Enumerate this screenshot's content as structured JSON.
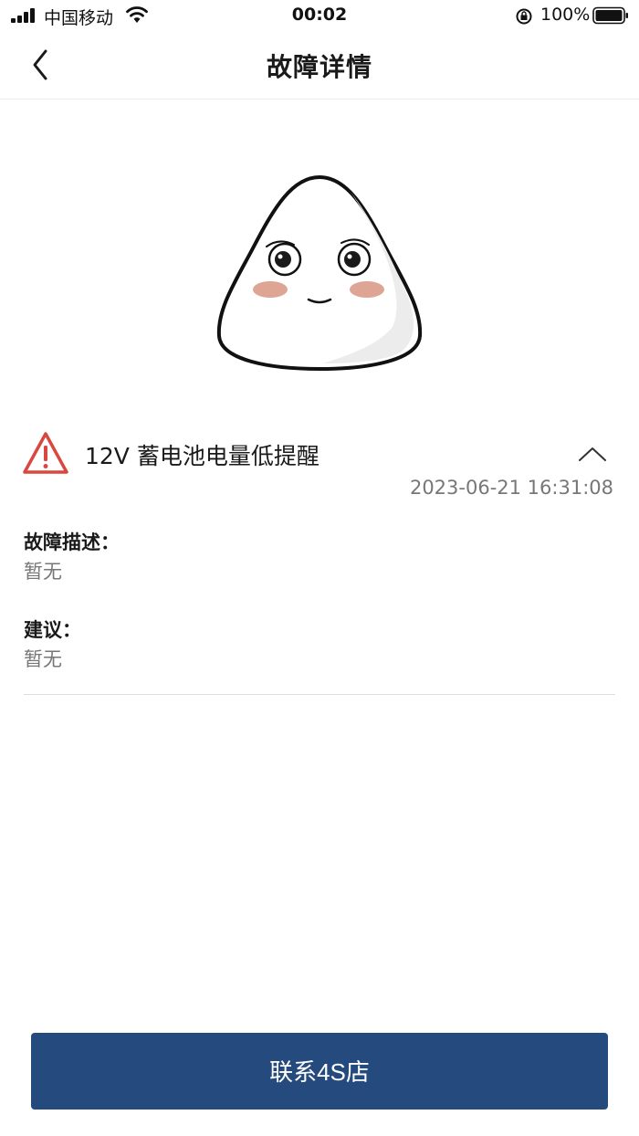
{
  "status_bar": {
    "carrier": "中国移动",
    "time": "00:02",
    "battery": "100%"
  },
  "nav": {
    "title": "故障详情"
  },
  "fault": {
    "title": "12V 蓄电池电量低提醒",
    "time": "2023-06-21 16:31:08",
    "description_label": "故障描述：",
    "description_value": "暂无",
    "suggestion_label": "建议：",
    "suggestion_value": "暂无"
  },
  "actions": {
    "contact_label": "联系4S店"
  },
  "colors": {
    "primary": "#244a7e",
    "warning": "#d9473f",
    "secondary_text": "#777777"
  },
  "icons": {
    "back": "chevron-left-icon",
    "warning": "warning-triangle-icon",
    "collapse": "chevron-up-icon"
  }
}
